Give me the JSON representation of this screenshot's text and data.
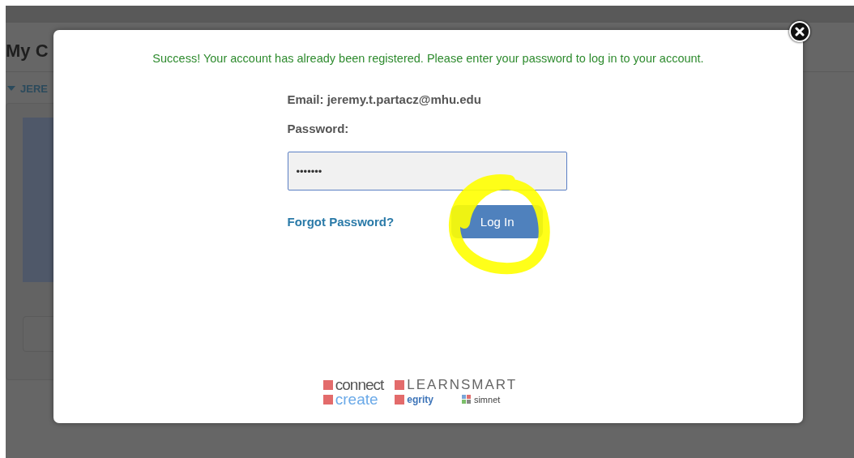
{
  "background_page": {
    "heading": "My C",
    "section_toggle": {
      "label": "JERE",
      "expanded": true
    }
  },
  "dialog": {
    "message": "Success! Your account has already been registered. Please enter your password to log in to your account.",
    "email_label": "Email: jeremy.t.partacz@mhu.edu",
    "password_label": "Password:",
    "password_field": {
      "value": "•••••••"
    },
    "forgot_link": "Forgot Password?",
    "login_button": "Log In",
    "logos": [
      {
        "kind": "connect",
        "text": "connect"
      },
      {
        "kind": "learnsmart",
        "text": "LEARNSMART"
      },
      {
        "kind": "create",
        "text": "create"
      },
      {
        "kind": "tegrity",
        "text": "egrity"
      },
      {
        "kind": "simnet",
        "text": "simnet"
      }
    ]
  }
}
